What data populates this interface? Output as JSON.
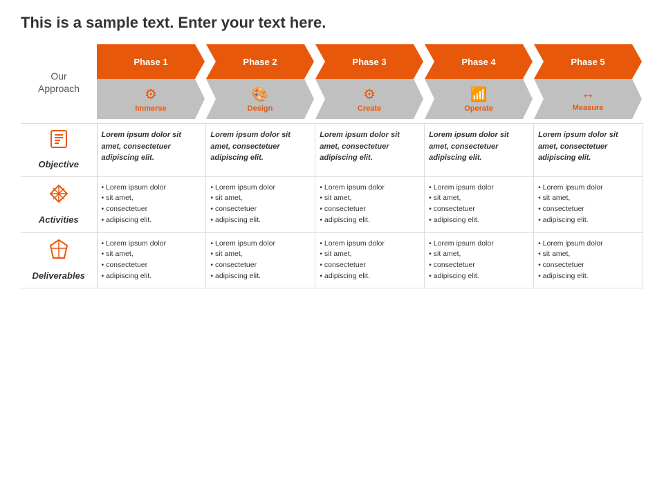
{
  "title": "This is a sample text. Enter your text here.",
  "approach_label": "Our\nApproach",
  "phases": [
    {
      "id": 1,
      "label": "Phase 1",
      "icon": "⚙",
      "sub_label": "Immerse"
    },
    {
      "id": 2,
      "label": "Phase 2",
      "icon": "🎨",
      "sub_label": "Design"
    },
    {
      "id": 3,
      "label": "Phase 3",
      "icon": "⚙",
      "sub_label": "Create"
    },
    {
      "id": 4,
      "label": "Phase 4",
      "icon": "📶",
      "sub_label": "Operate"
    },
    {
      "id": 5,
      "label": "Phase 5",
      "icon": "↔",
      "sub_label": "Measure"
    }
  ],
  "rows": [
    {
      "id": "objective",
      "icon_unicode": "📋",
      "label": "Objective",
      "type": "italic_bold",
      "cells": [
        "Lorem ipsum dolor sit amet, consectetuer adipiscing elit.",
        "Lorem ipsum dolor sit amet, consectetuer adipiscing elit.",
        "Lorem ipsum dolor sit amet, consectetuer adipiscing elit.",
        "Lorem ipsum dolor sit amet, consectetuer adipiscing elit.",
        "Lorem ipsum dolor sit amet, consectetuer adipiscing elit."
      ]
    },
    {
      "id": "activities",
      "icon_unicode": "✦",
      "label": "Activities",
      "type": "bullets",
      "cells": [
        [
          "Lorem ipsum dolor",
          "sit amet,",
          "consectetuer",
          "adipiscing elit."
        ],
        [
          "Lorem ipsum dolor",
          "sit amet,",
          "consectetuer",
          "adipiscing elit."
        ],
        [
          "Lorem ipsum dolor",
          "sit amet,",
          "consectetuer",
          "adipiscing elit."
        ],
        [
          "Lorem ipsum dolor",
          "sit amet,",
          "consectetuer",
          "adipiscing elit."
        ],
        [
          "Lorem ipsum dolor",
          "sit amet,",
          "consectetuer",
          "adipiscing elit."
        ]
      ]
    },
    {
      "id": "deliverables",
      "icon_unicode": "⌛",
      "label": "Deliverables",
      "type": "bullets",
      "cells": [
        [
          "Lorem ipsum dolor",
          "sit amet,",
          "consectetuer",
          "adipiscing elit."
        ],
        [
          "Lorem ipsum dolor",
          "sit amet,",
          "consectetuer",
          "adipiscing elit."
        ],
        [
          "Lorem ipsum dolor",
          "sit amet,",
          "consectetuer",
          "adipiscing elit."
        ],
        [
          "Lorem ipsum dolor",
          "sit amet,",
          "consectetuer",
          "adipiscing elit."
        ],
        [
          "Lorem ipsum dolor",
          "sit amet,",
          "consectetuer",
          "adipiscing elit."
        ]
      ]
    }
  ],
  "colors": {
    "orange": "#e8580a",
    "gray": "#bbb"
  }
}
